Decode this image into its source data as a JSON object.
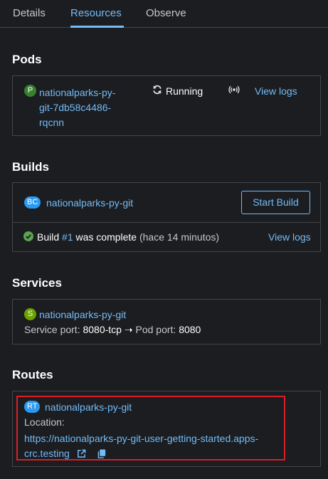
{
  "tabs": [
    {
      "label": "Details"
    },
    {
      "label": "Resources"
    },
    {
      "label": "Observe"
    }
  ],
  "pods": {
    "title": "Pods",
    "badge": "P",
    "name_lines": [
      "nationalparks-py-",
      "git-7db58c4486-",
      "rqcnn"
    ],
    "status": "Running",
    "view_logs": "View logs"
  },
  "builds": {
    "title": "Builds",
    "badge": "BC",
    "name": "nationalparks-py-git",
    "start_build": "Start Build",
    "build_prefix": "Build",
    "build_number": "#1",
    "build_suffix": "was complete",
    "build_time": "(hace 14 minutos)",
    "view_logs": "View logs"
  },
  "services": {
    "title": "Services",
    "badge": "S",
    "name": "nationalparks-py-git",
    "service_port_label": "Service port:",
    "service_port": "8080-tcp",
    "pod_port_label": "Pod port:",
    "pod_port": "8080"
  },
  "routes": {
    "title": "Routes",
    "badge": "RT",
    "name": "nationalparks-py-git",
    "location_label": "Location:",
    "url_line1": "https://nationalparks-py-git-user-getting-started.apps-",
    "url_line2": "crc.testing"
  }
}
